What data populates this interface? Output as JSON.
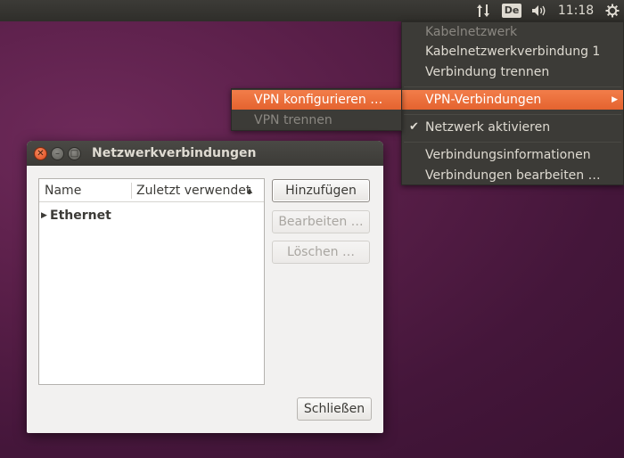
{
  "top_panel": {
    "network_icon": "network-updown-icon",
    "keyboard_layout": "De",
    "volume_icon": "speaker-icon",
    "clock": "11:18",
    "session_icon": "gear-icon"
  },
  "network_menu": {
    "section_header": "Kabelnetzwerk",
    "items": [
      {
        "label": "Kabelnetzwerkverbindung 1"
      },
      {
        "label": "Verbindung trennen"
      },
      {
        "label": "VPN-Verbindungen",
        "has_submenu": true,
        "highlighted": true
      },
      {
        "label": "Netzwerk aktivieren",
        "checked": true
      },
      {
        "label": "Verbindungsinformationen"
      },
      {
        "label": "Verbindungen bearbeiten …"
      }
    ]
  },
  "vpn_submenu": {
    "items": [
      {
        "label": "VPN konfigurieren …",
        "highlighted": true
      },
      {
        "label": "VPN trennen",
        "disabled": true
      }
    ]
  },
  "dialog": {
    "title": "Netzwerkverbindungen",
    "columns": [
      "Name",
      "Zuletzt verwendet"
    ],
    "sort_indicator": "▲",
    "rows": [
      {
        "label": "Ethernet",
        "expander": "▶"
      }
    ],
    "buttons": {
      "add": "Hinzufügen",
      "edit": "Bearbeiten …",
      "delete": "Löschen …",
      "close": "Schließen"
    }
  },
  "colors": {
    "highlight": "#e4632f",
    "panel": "#3c3b37",
    "desktop": "#5a1f49"
  }
}
